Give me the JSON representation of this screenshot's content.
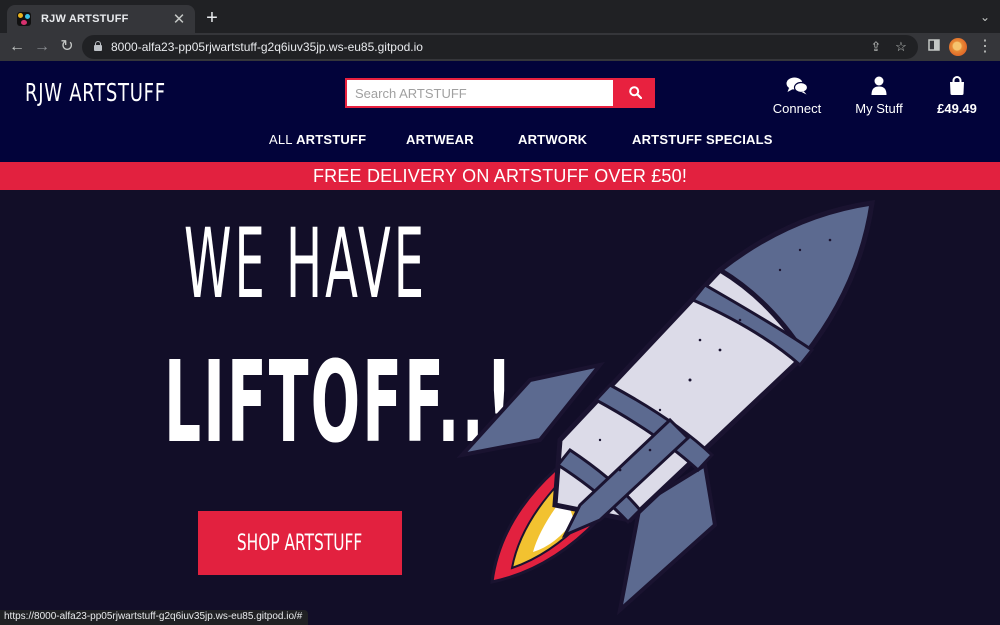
{
  "browser": {
    "tab_title": "RJW ARTSTUFF",
    "tab_close": "✕",
    "new_tab": "+",
    "url": "8000-alfa23-pp05rjwartstuff-g2q6iuv35jp.ws-eu85.gitpod.io",
    "status_url": "https://8000-alfa23-pp05rjwartstuff-g2q6iuv35jp.ws-eu85.gitpod.io/#"
  },
  "site": {
    "logo": "RJW ARTSTUFF",
    "search": {
      "placeholder": "Search ARTSTUFF"
    },
    "account": {
      "connect_label": "Connect",
      "my_stuff_label": "My Stuff",
      "bag_total": "£49.49"
    },
    "nav": {
      "all_prefix": "ALL",
      "all_main": "ARTSTUFF",
      "artwear": "ARTWEAR",
      "artwork": "ARTWORK",
      "specials": "ARTSTUFF SPECIALS"
    },
    "banner": "FREE DELIVERY ON ARTSTUFF OVER £50!",
    "hero": {
      "line1": "WE HAVE",
      "line2": "LIFTOFF..!",
      "cta": "SHOP ARTSTUFF"
    }
  },
  "colors": {
    "header_bg": "#02033a",
    "accent_red": "#e2213f",
    "hero_bg": "#120e28"
  },
  "icons": [
    "lock-icon",
    "search-icon",
    "chat-icon",
    "user-icon",
    "shopping-bag-icon",
    "rocket-illustration"
  ]
}
